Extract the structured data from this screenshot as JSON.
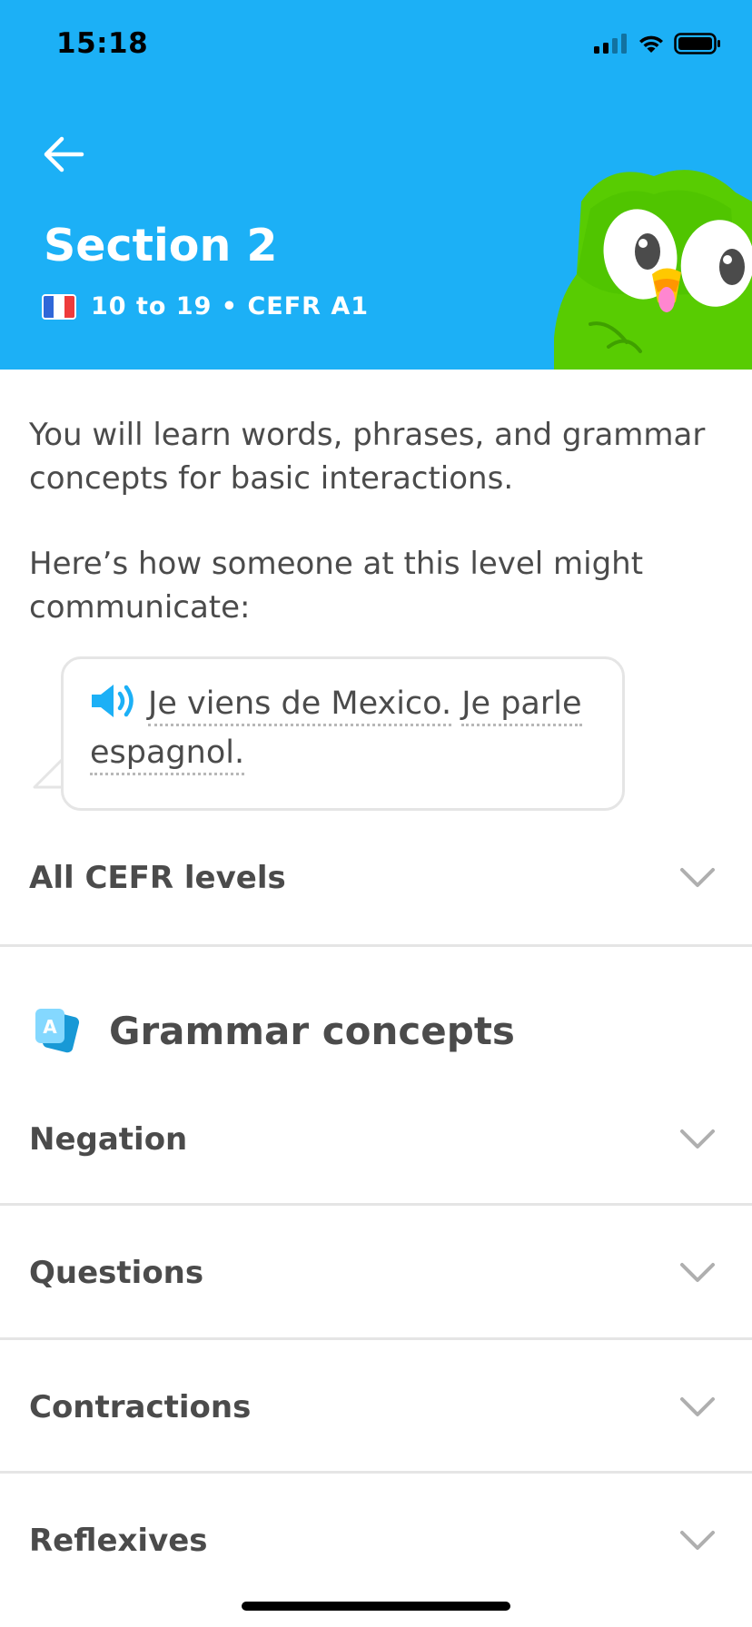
{
  "status_bar": {
    "time": "15:18"
  },
  "header": {
    "title": "Section 2",
    "subtitle": "10 to 19 • CEFR A1",
    "flag": "france-flag",
    "background_color": "#1cb0f6"
  },
  "intro": {
    "paragraph1": "You will learn words, phrases, and grammar concepts for basic interactions.",
    "paragraph2": "Here’s how someone at this level might communicate:"
  },
  "example": {
    "word1": "Je viens de Mexico.",
    "word2": "Je parle",
    "word3": "espagnol."
  },
  "cefr": {
    "label": "All CEFR levels"
  },
  "grammar": {
    "title": "Grammar concepts",
    "items": [
      {
        "label": "Negation"
      },
      {
        "label": "Questions"
      },
      {
        "label": "Contractions"
      },
      {
        "label": "Reflexives"
      }
    ]
  }
}
